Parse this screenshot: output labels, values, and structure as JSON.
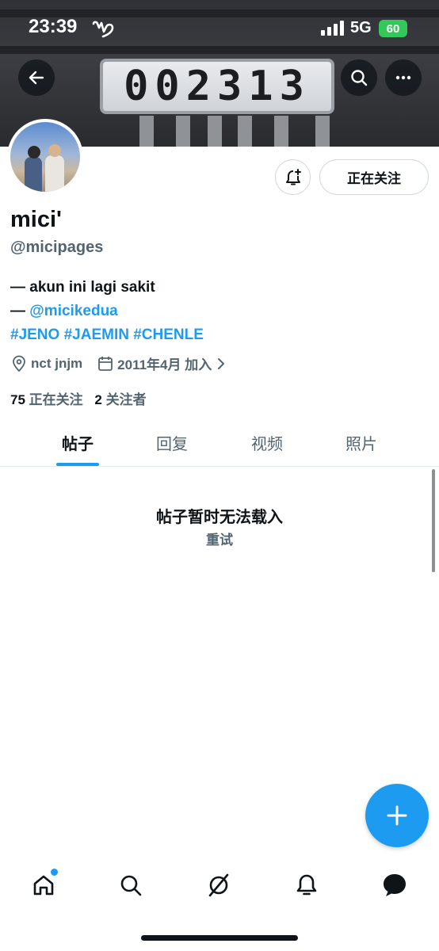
{
  "status_bar": {
    "time": "23:39",
    "network": "5G",
    "battery": "60"
  },
  "banner": {
    "plate_text": "002313"
  },
  "profile": {
    "name": "mici'",
    "handle": "@micipages",
    "bio_line1": "— akun ini lagi sakit",
    "bio_line2_prefix": "— ",
    "bio_mention": "@micikedua",
    "hashtags": [
      "#JENO",
      "#JAEMIN",
      "#CHENLE"
    ],
    "location": "nct jnjm",
    "joined": "2011年4月 加入",
    "following_count": "75",
    "following_label": "正在关注",
    "followers_count": "2",
    "followers_label": "关注者"
  },
  "actions": {
    "follow_label": "正在关注"
  },
  "tabs": [
    "帖子",
    "回复",
    "视频",
    "照片"
  ],
  "empty_state": {
    "title": "帖子暂时无法载入",
    "retry": "重试"
  },
  "colors": {
    "accent": "#1d9bf0",
    "text": "#0f1419",
    "secondary": "#536471"
  },
  "icons": {
    "top": [
      "back-icon",
      "search-icon",
      "more-icon"
    ],
    "nav": [
      "home-icon",
      "search-icon",
      "grok-icon",
      "notifications-icon",
      "messages-icon"
    ]
  }
}
